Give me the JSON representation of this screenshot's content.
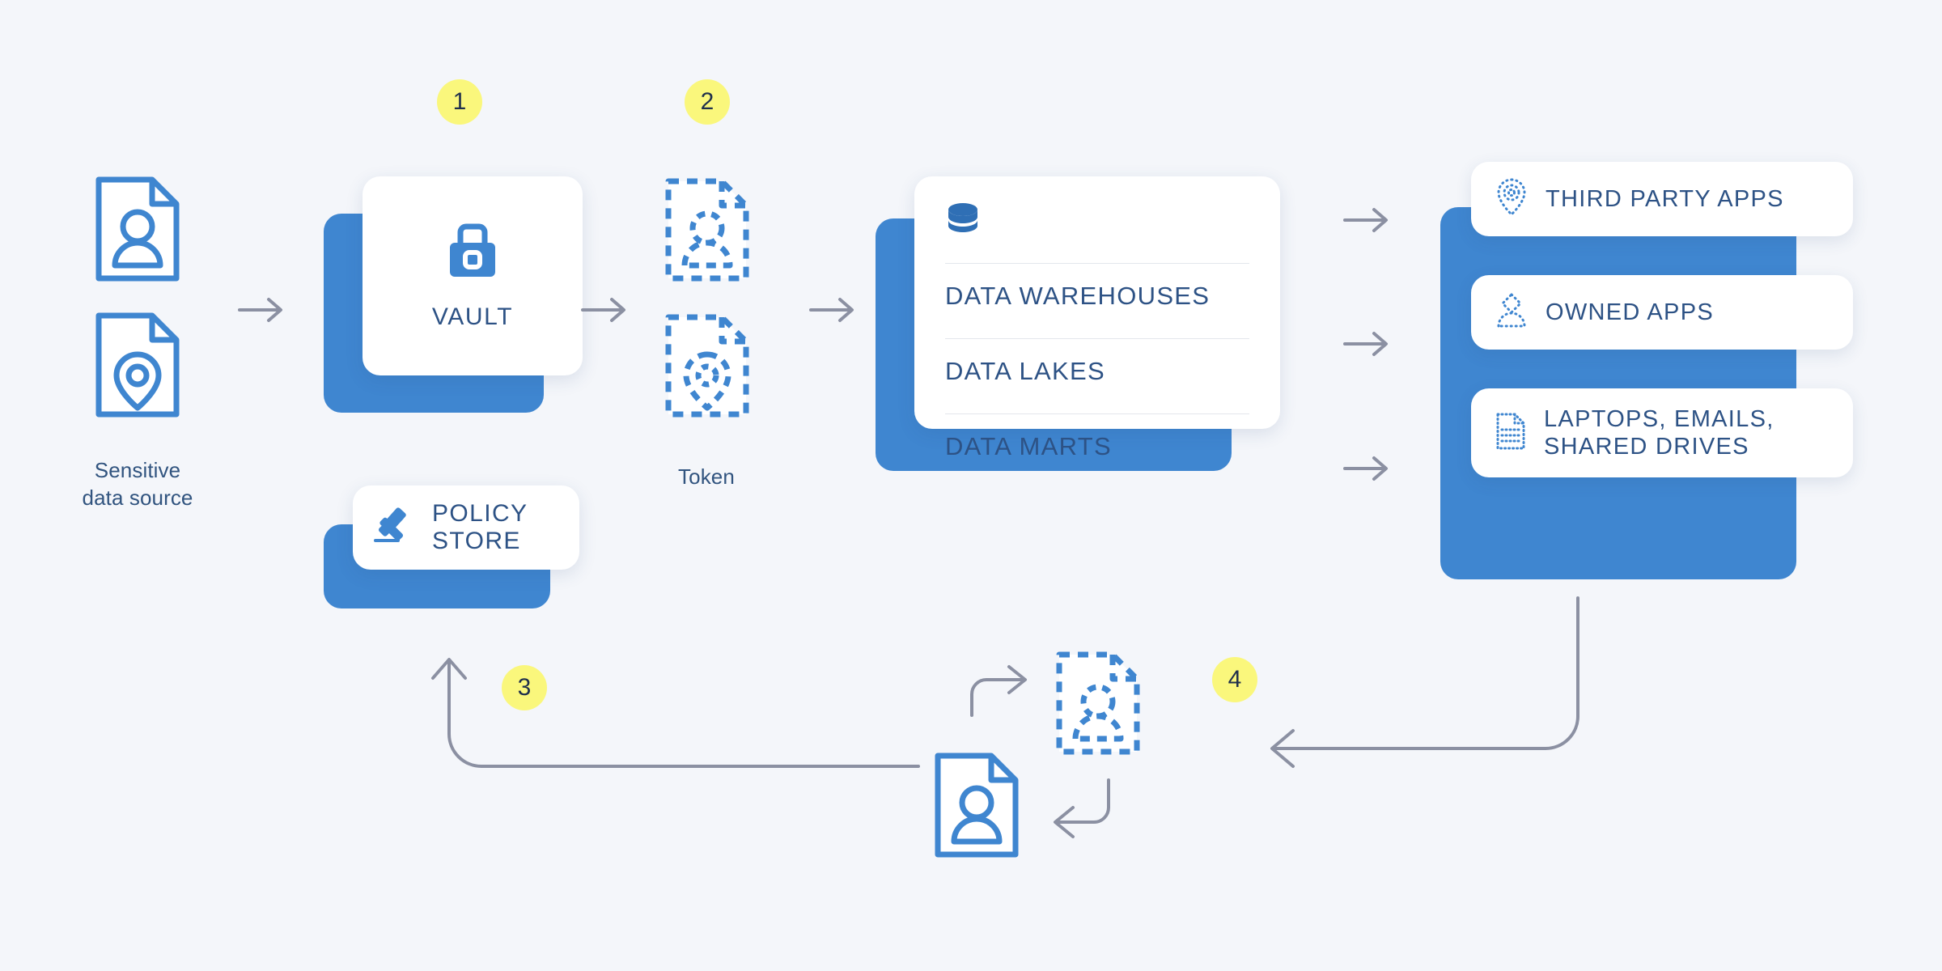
{
  "theme": {
    "background": "#f4f6fa",
    "brand_blue": "#3f86d0",
    "deep_blue_text": "#2d5285",
    "badge_yellow": "#faf77c",
    "arrow_gray": "#8b90a2"
  },
  "source": {
    "caption_line1": "Sensitive",
    "caption_line2": "data source",
    "icons": [
      "person-document-icon",
      "location-document-icon"
    ]
  },
  "vault": {
    "label": "VAULT",
    "icon": "padlock-icon"
  },
  "policy_store": {
    "label_line1": "POLICY",
    "label_line2": "STORE",
    "icon": "gavel-icon"
  },
  "token": {
    "caption": "Token",
    "icons": [
      "dashed-person-document-icon",
      "dashed-location-document-icon"
    ]
  },
  "data_platform": {
    "icon": "database-icon",
    "items": [
      "DATA WAREHOUSES",
      "DATA LAKES",
      "DATA MARTS"
    ]
  },
  "destinations": [
    {
      "label": "THIRD PARTY APPS",
      "icon": "dotted-location-pin-icon"
    },
    {
      "label": "OWNED APPS",
      "icon": "dotted-person-icon"
    },
    {
      "label": "LAPTOPS, EMAILS,\nSHARED DRIVES",
      "label_line1": "LAPTOPS, EMAILS,",
      "label_line2": "SHARED DRIVES",
      "icon": "dotted-file-icon"
    }
  ],
  "steps": [
    {
      "number": "1",
      "anchor": "vault"
    },
    {
      "number": "2",
      "anchor": "token"
    },
    {
      "number": "3",
      "anchor": "policy-return"
    },
    {
      "number": "4",
      "anchor": "detokenize-return"
    }
  ],
  "exchange": {
    "tokenized_doc_icon": "dashed-person-document-icon",
    "detokenized_doc_icon": "person-document-icon",
    "arrow_out_icon": "curved-arrow-up-right-icon",
    "arrow_in_icon": "curved-arrow-down-left-icon"
  },
  "flow_arrows": [
    "source-to-vault",
    "vault-to-token",
    "token-to-data",
    "data-to-third-party-apps",
    "data-to-owned-apps",
    "data-to-laptops"
  ]
}
